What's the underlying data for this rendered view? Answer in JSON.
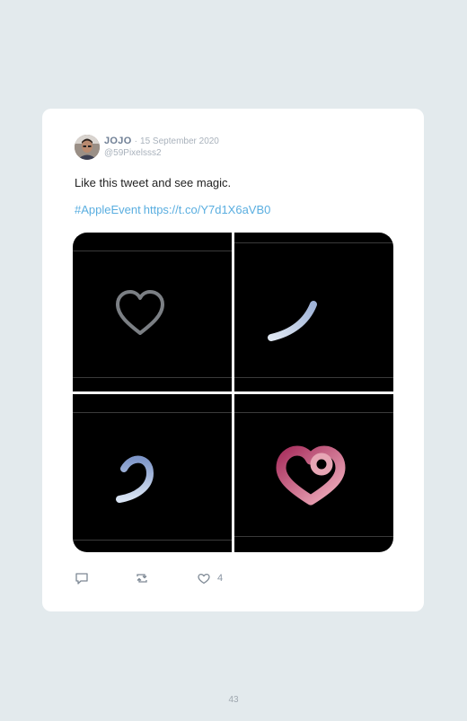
{
  "tweet": {
    "name": "JOJO",
    "separator": "·",
    "date": "15 September 2020",
    "handle": "@59Pixelsss2",
    "text": "Like this tweet and see magic.",
    "hashtag": "#AppleEvent",
    "link": "https://t.co/Y7d1X6aVB0",
    "media": [
      {
        "icon": "heart-outline-gray-icon"
      },
      {
        "icon": "blue-stroke-arc-icon"
      },
      {
        "icon": "blue-stroke-hook-icon"
      },
      {
        "icon": "pink-heart-icon"
      }
    ],
    "actions": {
      "reply_icon": "reply-icon",
      "retweet_icon": "retweet-icon",
      "like_icon": "heart-icon",
      "like_count": "4"
    }
  },
  "page_number": "43",
  "colors": {
    "background": "#e3eaed",
    "card": "#ffffff",
    "link": "#5aaee0",
    "name": "#6f7f95",
    "muted": "#a9b2bc"
  }
}
